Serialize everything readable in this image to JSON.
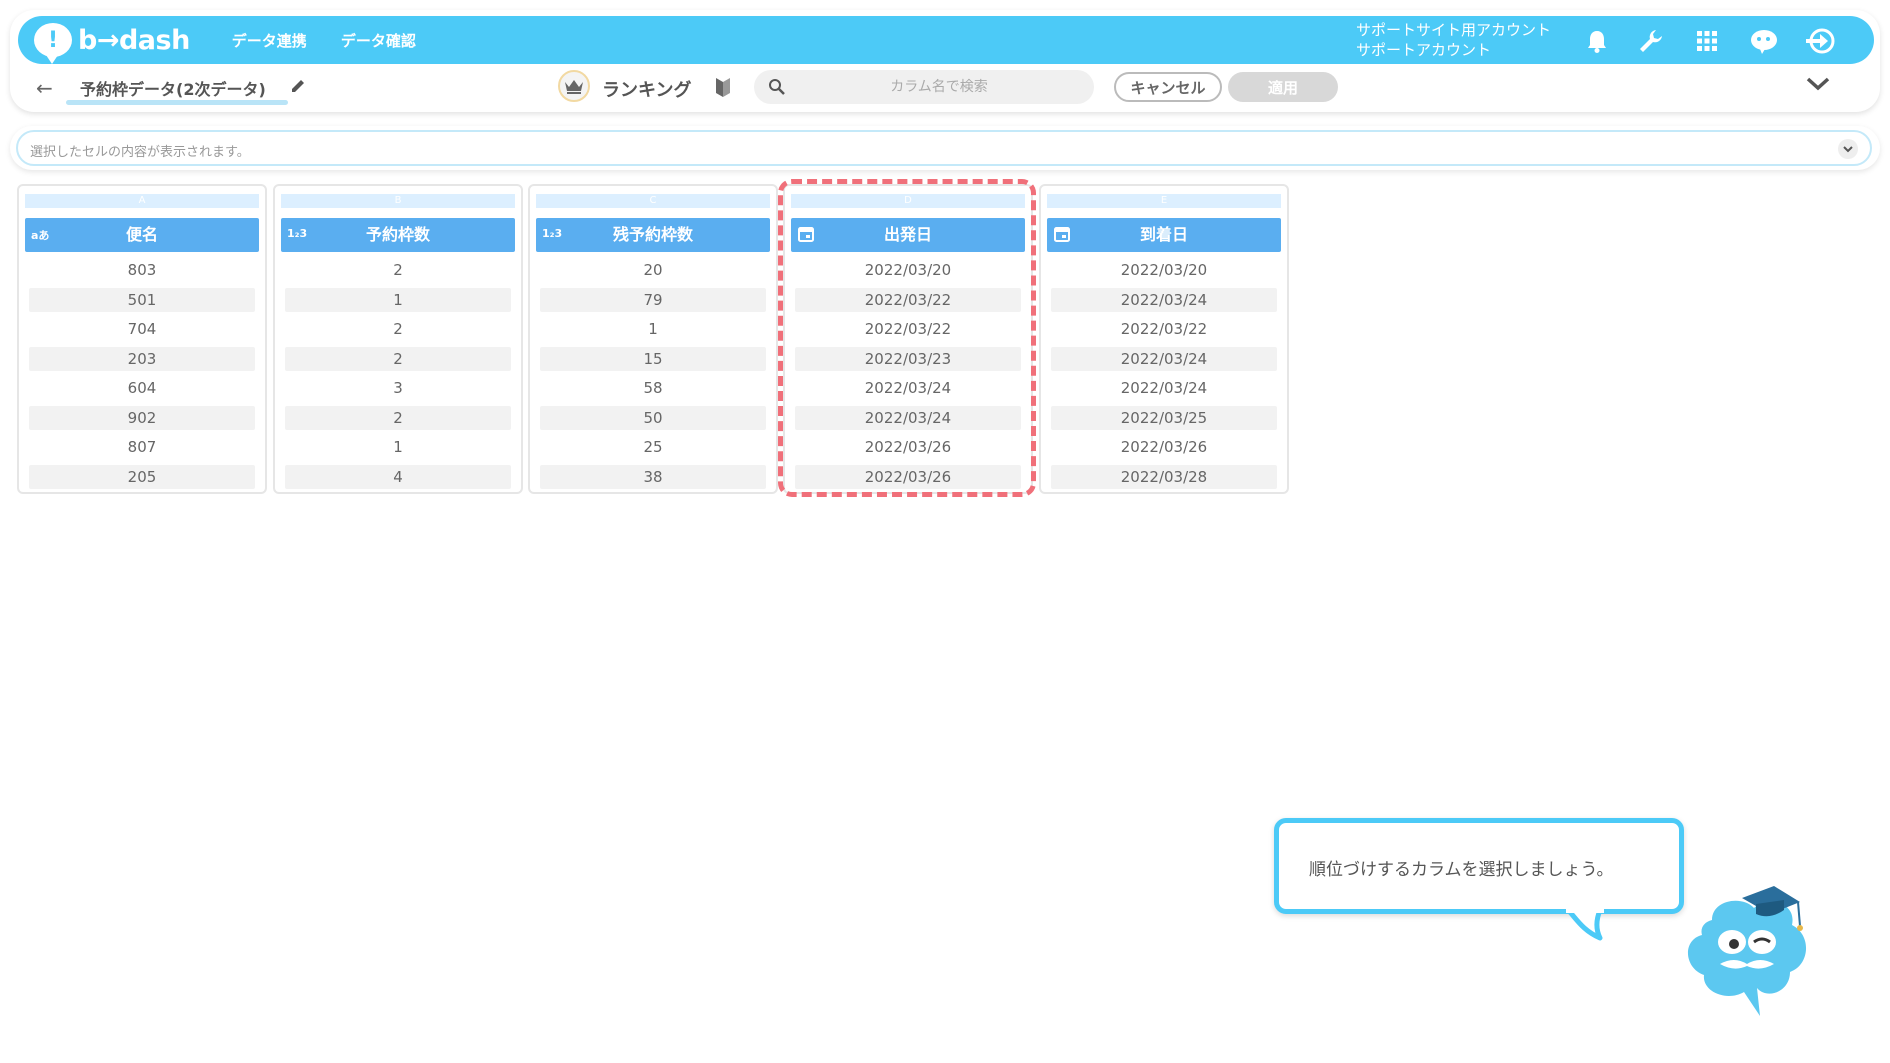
{
  "header": {
    "logo_mark": "!",
    "logo_text": "b→dash",
    "nav": [
      "データ連携",
      "データ確認"
    ],
    "account_line1": "サポートサイト用アカウント",
    "account_line2": "サポートアカウント",
    "icons": [
      "bell-icon",
      "wrench-icon",
      "apps-grid-icon",
      "chat-bot-icon",
      "logout-icon"
    ]
  },
  "toolbar": {
    "back_arrow": "←",
    "data_title": "予約枠データ(2次データ)",
    "ranking_label": "ランキング",
    "search_placeholder": "カラム名で検索",
    "cancel_label": "キャンセル",
    "apply_label": "適用"
  },
  "cellbar": {
    "placeholder": "選択したセルの内容が表示されます。"
  },
  "columns": [
    {
      "letter": "A",
      "type_badge": "aあ",
      "name": "便名",
      "rows": [
        "803",
        "501",
        "704",
        "203",
        "604",
        "902",
        "807",
        "205"
      ]
    },
    {
      "letter": "B",
      "type_badge": "1₂3",
      "name": "予約枠数",
      "rows": [
        "2",
        "1",
        "2",
        "2",
        "3",
        "2",
        "1",
        "4"
      ]
    },
    {
      "letter": "C",
      "type_badge": "1₂3",
      "name": "残予約枠数",
      "rows": [
        "20",
        "79",
        "1",
        "15",
        "58",
        "50",
        "25",
        "38"
      ]
    },
    {
      "letter": "D",
      "type_badge": "calendar-icon",
      "name": "出発日",
      "rows": [
        "2022/03/20",
        "2022/03/22",
        "2022/03/22",
        "2022/03/23",
        "2022/03/24",
        "2022/03/24",
        "2022/03/26",
        "2022/03/26"
      ]
    },
    {
      "letter": "E",
      "type_badge": "calendar-icon",
      "name": "到着日",
      "rows": [
        "2022/03/20",
        "2022/03/24",
        "2022/03/22",
        "2022/03/24",
        "2022/03/24",
        "2022/03/25",
        "2022/03/26",
        "2022/03/28"
      ]
    }
  ],
  "highlighted_column": "D",
  "tooltip": {
    "text": "順位づけするカラムを選択しましょう。"
  },
  "colors": {
    "brand": "#4ccaf7",
    "column_header": "#5aaef0",
    "highlight_dash": "#f0707a"
  }
}
